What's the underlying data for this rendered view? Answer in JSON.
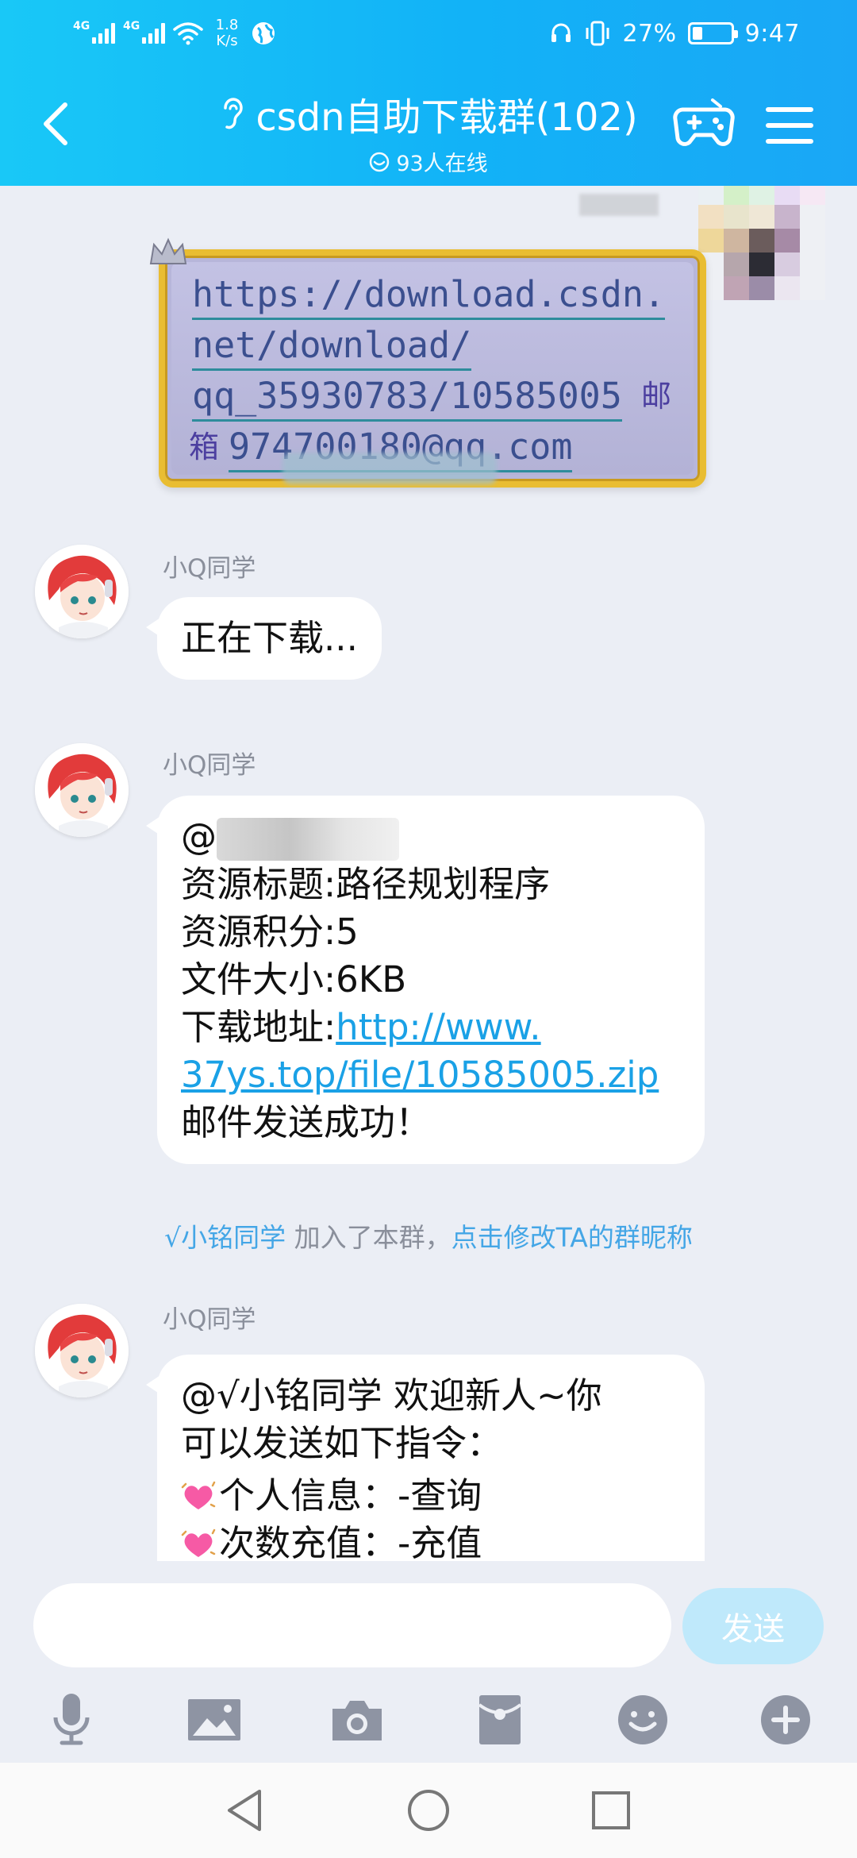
{
  "status_bar": {
    "net1": "4G",
    "net2": "4G",
    "speed_value": "1.8",
    "speed_unit": "K/s",
    "battery": "27%",
    "battery_level": 0.27,
    "time": "9:47"
  },
  "header": {
    "title": "csdn自助下载群(102)",
    "online": "93人在线"
  },
  "image_message": {
    "lines": [
      "https://download.csdn.",
      "net/download/",
      "qq_35930783/10585005",
      "974700180@qq.com"
    ],
    "mail_char_1": "邮",
    "mail_char_2": "箱"
  },
  "messages": [
    {
      "sender": "小Q同学",
      "text": "正在下载..."
    },
    {
      "sender": "小Q同学",
      "mention": "@",
      "lines": [
        "资源标题:路径规划程序",
        "资源积分:5",
        "文件大小:6KB"
      ],
      "link_label": "下载地址:",
      "link_1": "http://www.",
      "link_2": "37ys.top/file/10585005.zip",
      "last_line": "邮件发送成功！"
    },
    {
      "sender": "小Q同学",
      "line1": "@√小铭同学 欢迎新人~你",
      "line2": "可以发送如下指令：",
      "cmd1": "个人信息：-查询",
      "cmd2": "次数充值：-充值"
    }
  ],
  "system_notice": {
    "name": "√小铭同学",
    "action": "加入了本群，",
    "link": "点击修改TA的群昵称"
  },
  "input": {
    "placeholder": "",
    "send_label": "发送"
  },
  "colors": {
    "header": "#12b2f7",
    "link": "#1aa1e6",
    "send_disabled": "#bfe9fb",
    "chat_bg": "#ebeef5"
  }
}
